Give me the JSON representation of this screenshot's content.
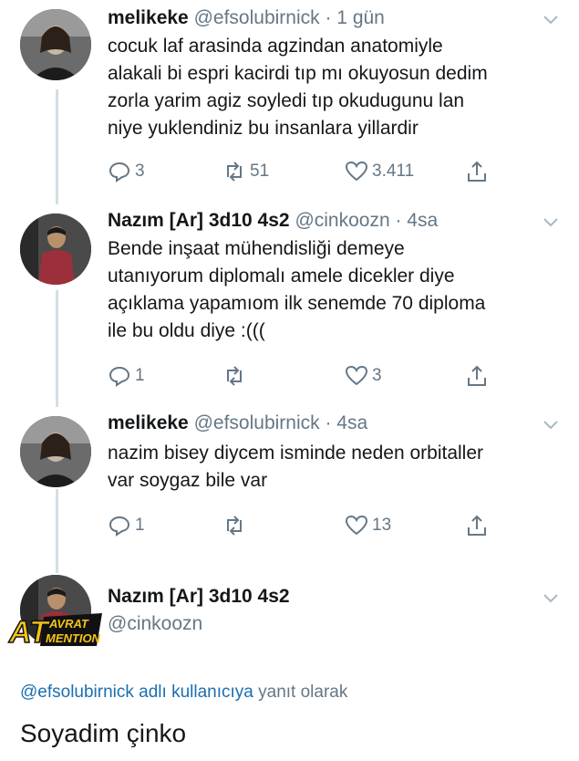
{
  "tweets": [
    {
      "name": "melikeke",
      "handle": "@efsolubirnick",
      "time": "· 1 gün",
      "lines": [
        "cocuk laf arasinda agzindan anatomiyle",
        "alakali bi espri kacirdi tıp mı okuyosun dedim",
        "zorla yarim agiz soyledi tıp okudugunu lan",
        "niye yuklendiniz bu insanlara yillardir"
      ],
      "replies": "3",
      "retweets": "51",
      "likes": "3.411"
    },
    {
      "name": "Nazım [Ar] 3d10 4s2",
      "handle": "@cinkoozn",
      "time": "· 4sa",
      "lines": [
        "Bende inşaat mühendisliği demeye",
        "utanıyorum diplomalı amele dicekler diye",
        "açıklama yapamıom ilk senemde 70 diploma",
        "ile bu oldu diye :((("
      ],
      "replies": "1",
      "retweets": "",
      "likes": "3"
    },
    {
      "name": "melikeke",
      "handle": "@efsolubirnick",
      "time": "· 4sa",
      "lines": [
        "nazim bisey diycem isminde neden orbitaller",
        "var soygaz bile var"
      ],
      "replies": "1",
      "retweets": "",
      "likes": "13"
    }
  ],
  "main_tweet": {
    "name": "Nazım [Ar] 3d10 4s2",
    "handle": "@cinkoozn",
    "reply_prefix": "@efsolubirnick adlı kullanıcıya",
    "reply_suffix": "yanıt olarak",
    "text": "Soyadim çinko"
  },
  "watermark": {
    "big": "AT",
    "top": "AVRAT",
    "bottom": "MENTION"
  },
  "icons": {
    "reply": "reply-icon",
    "retweet": "retweet-icon",
    "like": "heart-icon",
    "share": "share-icon",
    "menu": "chevron-down-icon"
  },
  "colors": {
    "text": "#14171a",
    "muted": "#657786",
    "link": "#1b6fb0",
    "thread_line": "#d4dde4"
  }
}
